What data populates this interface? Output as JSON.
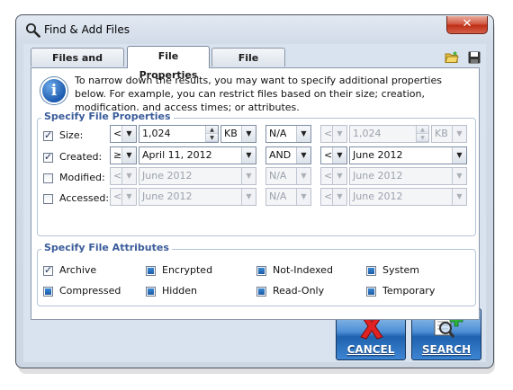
{
  "window": {
    "title": "Find & Add Files",
    "close_glyph": "✕"
  },
  "tabs": [
    {
      "label": "Files and Folders",
      "active": false
    },
    {
      "label": "File Properties",
      "active": true
    },
    {
      "label": "File Contents",
      "active": false
    }
  ],
  "toolbar_icons": [
    "open-folder-icon",
    "save-disk-icon"
  ],
  "info": {
    "icon": "info-icon",
    "glyph": "i",
    "text": "To narrow down the results, you may want to specify additional properties below. For example, you can restrict files based on their size; creation, modification, and access times; or attributes."
  },
  "properties": {
    "title": "Specify File Properties",
    "rows": [
      {
        "label": "Size:",
        "checked": true,
        "op1": "<",
        "value1": "1,024",
        "unit1": "KB",
        "conj": "N/A",
        "op2": "<",
        "value2": "1,024",
        "unit2": "KB"
      },
      {
        "label": "Created:",
        "checked": true,
        "op1": "≥",
        "value1": "April 11, 2012",
        "conj": "AND",
        "op2": "<",
        "value2": "June 2012"
      },
      {
        "label": "Modified:",
        "checked": false,
        "op1": "<",
        "value1": "June 2012",
        "conj": "N/A",
        "op2": "<",
        "value2": "June 2012"
      },
      {
        "label": "Accessed:",
        "checked": false,
        "op1": "<",
        "value1": "June 2012",
        "conj": "N/A",
        "op2": "<",
        "value2": "June 2012"
      }
    ]
  },
  "attributes": {
    "title": "Specify File Attributes",
    "items": [
      {
        "label": "Archive",
        "state": "checked"
      },
      {
        "label": "Encrypted",
        "state": "indeterminate"
      },
      {
        "label": "Not-Indexed",
        "state": "indeterminate"
      },
      {
        "label": "System",
        "state": "indeterminate"
      },
      {
        "label": "Compressed",
        "state": "indeterminate"
      },
      {
        "label": "Hidden",
        "state": "indeterminate"
      },
      {
        "label": "Read-Only",
        "state": "indeterminate"
      },
      {
        "label": "Temporary",
        "state": "indeterminate"
      }
    ]
  },
  "buttons": {
    "cancel": {
      "label": "CANCEL",
      "icon": "red-x-icon"
    },
    "search": {
      "label": "SEARCH",
      "icon": "magnifier-plus-icon"
    }
  },
  "colors": {
    "accent_title": "#3a5c9a",
    "button_blue": "#1f62ae",
    "close_red": "#be2d14"
  }
}
